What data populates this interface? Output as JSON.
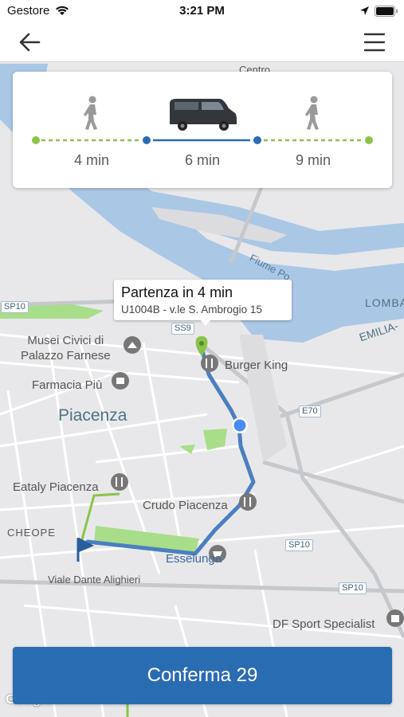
{
  "status_bar": {
    "carrier": "Gestore",
    "time": "3:21 PM"
  },
  "nav": {
    "back_icon": "arrow-left-icon",
    "menu_icon": "hamburger-menu-icon"
  },
  "trip": {
    "legs": [
      {
        "mode": "walk",
        "icon": "walking-person-icon",
        "duration": "4 min"
      },
      {
        "mode": "shuttle",
        "icon": "van-icon",
        "duration": "6 min"
      },
      {
        "mode": "walk",
        "icon": "walking-person-icon",
        "duration": "9 min"
      }
    ]
  },
  "callout": {
    "title": "Partenza in 4 min",
    "subtitle": "U1004B - v.le S. Ambrogio 15"
  },
  "map": {
    "labels": {
      "centro": "Centro",
      "musei": "Musei Civici di\nPalazzo Farnese",
      "farmacia": "Farmacia Più",
      "piacenza": "Piacenza",
      "burger_king": "Burger King",
      "eataly": "Eataly Piacenza",
      "crudo": "Crudo Piacenza",
      "cheope": "CHEOPE",
      "esselunga": "Esselunga",
      "viale_dante": "Viale Dante Alighieri",
      "df_sport": "DF Sport Specialist",
      "fiume_po": "Fiume Po",
      "lomba": "LOMBA",
      "emilia": "EMILIA-"
    },
    "road_badges": {
      "sp10_left": "SP10",
      "ss9": "SS9",
      "e70": "E70",
      "sp10_mid": "SP10",
      "sp10_low": "SP10"
    },
    "colors": {
      "route": "#4a7fc0",
      "walk_path": "#8bc34a",
      "water": "#aac7e5",
      "park": "#a8dd8a"
    }
  },
  "confirm_button": {
    "label": "Conferma 29"
  },
  "google_logo": "Google"
}
